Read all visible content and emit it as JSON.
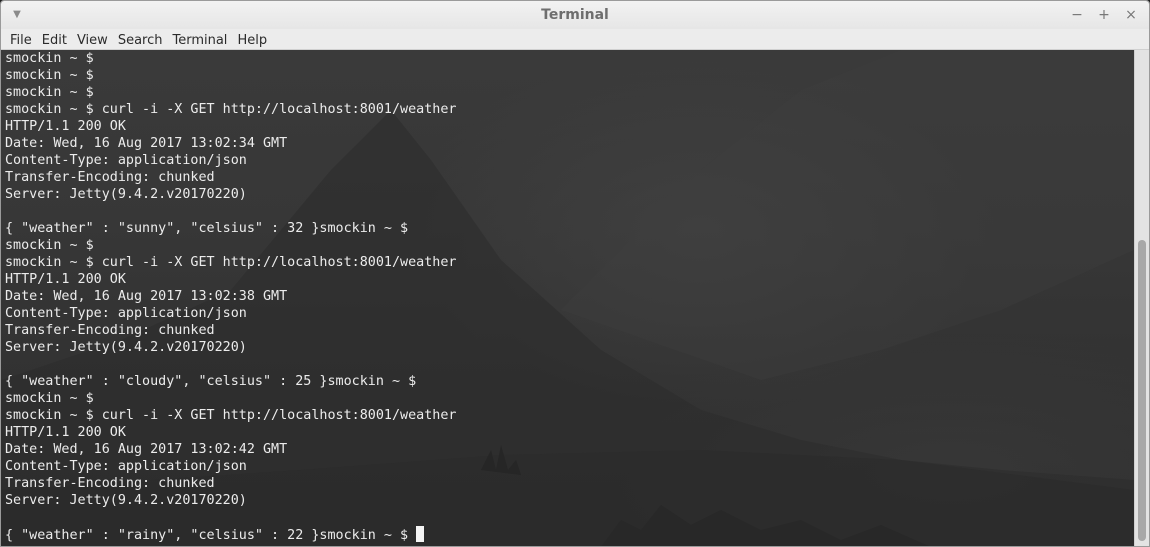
{
  "window": {
    "title": "Terminal",
    "controls": {
      "minimize": "−",
      "maximize": "+",
      "close": "×"
    }
  },
  "menubar": {
    "items": [
      {
        "label": "File"
      },
      {
        "label": "Edit"
      },
      {
        "label": "View"
      },
      {
        "label": "Search"
      },
      {
        "label": "Terminal"
      },
      {
        "label": "Help"
      }
    ]
  },
  "terminal": {
    "lines": [
      "smockin ~ $",
      "smockin ~ $",
      "smockin ~ $",
      "smockin ~ $ curl -i -X GET http://localhost:8001/weather",
      "HTTP/1.1 200 OK",
      "Date: Wed, 16 Aug 2017 13:02:34 GMT",
      "Content-Type: application/json",
      "Transfer-Encoding: chunked",
      "Server: Jetty(9.4.2.v20170220)",
      "",
      "{ \"weather\" : \"sunny\", \"celsius\" : 32 }smockin ~ $",
      "smockin ~ $",
      "smockin ~ $ curl -i -X GET http://localhost:8001/weather",
      "HTTP/1.1 200 OK",
      "Date: Wed, 16 Aug 2017 13:02:38 GMT",
      "Content-Type: application/json",
      "Transfer-Encoding: chunked",
      "Server: Jetty(9.4.2.v20170220)",
      "",
      "{ \"weather\" : \"cloudy\", \"celsius\" : 25 }smockin ~ $",
      "smockin ~ $",
      "smockin ~ $ curl -i -X GET http://localhost:8001/weather",
      "HTTP/1.1 200 OK",
      "Date: Wed, 16 Aug 2017 13:02:42 GMT",
      "Content-Type: application/json",
      "Transfer-Encoding: chunked",
      "Server: Jetty(9.4.2.v20170220)",
      "",
      "{ \"weather\" : \"rainy\", \"celsius\" : 22 }smockin ~ $ "
    ]
  },
  "colors": {
    "terminal_text": "#ececec",
    "terminal_background": "#353535",
    "titlebar": "#ececec"
  }
}
